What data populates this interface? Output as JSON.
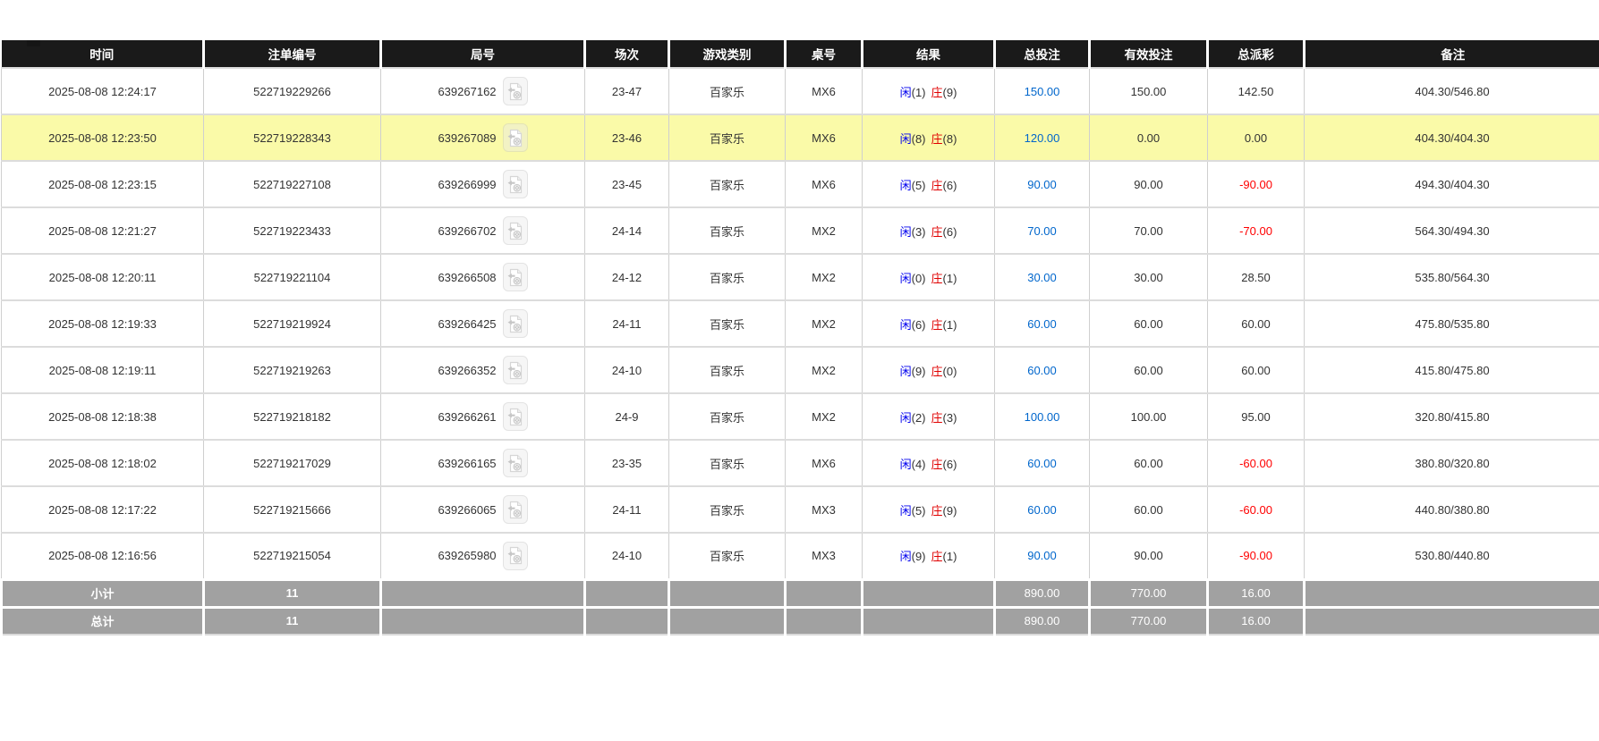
{
  "colors": {
    "header_bg": "#1a1a1a",
    "highlight_row": "#fafaa8",
    "footer_bg": "#a1a1a1",
    "amount_blue": "#0066cc",
    "player_blue": "#0000ee",
    "banker_red": "#e00000",
    "negative_red": "#ff0000"
  },
  "icons": {
    "game_replay": "video-replay-icon"
  },
  "table": {
    "columns": [
      "时间",
      "注单编号",
      "局号",
      "场次",
      "游戏类别",
      "桌号",
      "结果",
      "总投注",
      "有效投注",
      "总派彩",
      "备注"
    ],
    "rows": [
      {
        "time": "2025-08-08 12:24:17",
        "bet_id": "522719229266",
        "game_no": "639267162",
        "session": "23-47",
        "game_type": "百家乐",
        "table_no": "MX6",
        "player": "闲",
        "player_score": "(1)",
        "banker": "庄",
        "banker_score": "(9)",
        "total_bet": "150.00",
        "valid_bet": "150.00",
        "payout": "142.50",
        "remark": "404.30/546.80",
        "highlighted": false
      },
      {
        "time": "2025-08-08 12:23:50",
        "bet_id": "522719228343",
        "game_no": "639267089",
        "session": "23-46",
        "game_type": "百家乐",
        "table_no": "MX6",
        "player": "闲",
        "player_score": "(8)",
        "banker": "庄",
        "banker_score": "(8)",
        "total_bet": "120.00",
        "valid_bet": "0.00",
        "payout": "0.00",
        "remark": "404.30/404.30",
        "highlighted": true
      },
      {
        "time": "2025-08-08 12:23:15",
        "bet_id": "522719227108",
        "game_no": "639266999",
        "session": "23-45",
        "game_type": "百家乐",
        "table_no": "MX6",
        "player": "闲",
        "player_score": "(5)",
        "banker": "庄",
        "banker_score": "(6)",
        "total_bet": "90.00",
        "valid_bet": "90.00",
        "payout": "-90.00",
        "remark": "494.30/404.30",
        "highlighted": false
      },
      {
        "time": "2025-08-08 12:21:27",
        "bet_id": "522719223433",
        "game_no": "639266702",
        "session": "24-14",
        "game_type": "百家乐",
        "table_no": "MX2",
        "player": "闲",
        "player_score": "(3)",
        "banker": "庄",
        "banker_score": "(6)",
        "total_bet": "70.00",
        "valid_bet": "70.00",
        "payout": "-70.00",
        "remark": "564.30/494.30",
        "highlighted": false
      },
      {
        "time": "2025-08-08 12:20:11",
        "bet_id": "522719221104",
        "game_no": "639266508",
        "session": "24-12",
        "game_type": "百家乐",
        "table_no": "MX2",
        "player": "闲",
        "player_score": "(0)",
        "banker": "庄",
        "banker_score": "(1)",
        "total_bet": "30.00",
        "valid_bet": "30.00",
        "payout": "28.50",
        "remark": "535.80/564.30",
        "highlighted": false
      },
      {
        "time": "2025-08-08 12:19:33",
        "bet_id": "522719219924",
        "game_no": "639266425",
        "session": "24-11",
        "game_type": "百家乐",
        "table_no": "MX2",
        "player": "闲",
        "player_score": "(6)",
        "banker": "庄",
        "banker_score": "(1)",
        "total_bet": "60.00",
        "valid_bet": "60.00",
        "payout": "60.00",
        "remark": "475.80/535.80",
        "highlighted": false
      },
      {
        "time": "2025-08-08 12:19:11",
        "bet_id": "522719219263",
        "game_no": "639266352",
        "session": "24-10",
        "game_type": "百家乐",
        "table_no": "MX2",
        "player": "闲",
        "player_score": "(9)",
        "banker": "庄",
        "banker_score": "(0)",
        "total_bet": "60.00",
        "valid_bet": "60.00",
        "payout": "60.00",
        "remark": "415.80/475.80",
        "highlighted": false
      },
      {
        "time": "2025-08-08 12:18:38",
        "bet_id": "522719218182",
        "game_no": "639266261",
        "session": "24-9",
        "game_type": "百家乐",
        "table_no": "MX2",
        "player": "闲",
        "player_score": "(2)",
        "banker": "庄",
        "banker_score": "(3)",
        "total_bet": "100.00",
        "valid_bet": "100.00",
        "payout": "95.00",
        "remark": "320.80/415.80",
        "highlighted": false
      },
      {
        "time": "2025-08-08 12:18:02",
        "bet_id": "522719217029",
        "game_no": "639266165",
        "session": "23-35",
        "game_type": "百家乐",
        "table_no": "MX6",
        "player": "闲",
        "player_score": "(4)",
        "banker": "庄",
        "banker_score": "(6)",
        "total_bet": "60.00",
        "valid_bet": "60.00",
        "payout": "-60.00",
        "remark": "380.80/320.80",
        "highlighted": false
      },
      {
        "time": "2025-08-08 12:17:22",
        "bet_id": "522719215666",
        "game_no": "639266065",
        "session": "24-11",
        "game_type": "百家乐",
        "table_no": "MX3",
        "player": "闲",
        "player_score": "(5)",
        "banker": "庄",
        "banker_score": "(9)",
        "total_bet": "60.00",
        "valid_bet": "60.00",
        "payout": "-60.00",
        "remark": "440.80/380.80",
        "highlighted": false
      },
      {
        "time": "2025-08-08 12:16:56",
        "bet_id": "522719215054",
        "game_no": "639265980",
        "session": "24-10",
        "game_type": "百家乐",
        "table_no": "MX3",
        "player": "闲",
        "player_score": "(9)",
        "banker": "庄",
        "banker_score": "(1)",
        "total_bet": "90.00",
        "valid_bet": "90.00",
        "payout": "-90.00",
        "remark": "530.80/440.80",
        "highlighted": false
      }
    ],
    "footer": [
      {
        "label": "小计",
        "count": "11",
        "total_bet": "890.00",
        "valid_bet": "770.00",
        "payout": "16.00"
      },
      {
        "label": "总计",
        "count": "11",
        "total_bet": "890.00",
        "valid_bet": "770.00",
        "payout": "16.00"
      }
    ]
  }
}
